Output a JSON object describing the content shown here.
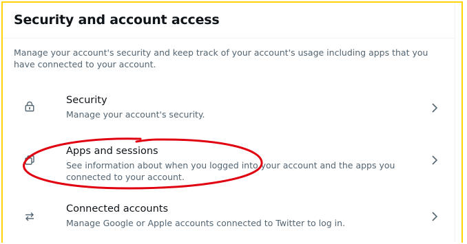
{
  "page": {
    "title": "Security and account access",
    "description": "Manage your account's security and keep track of your account's usage including apps that you have connected to your account."
  },
  "items": [
    {
      "label": "Security",
      "description": "Manage your account's security.",
      "icon": "lock-icon"
    },
    {
      "label": "Apps and sessions",
      "description": "See information about when you logged into your account and the apps you connected to your account.",
      "icon": "apps-icon"
    },
    {
      "label": "Connected accounts",
      "description": "Manage Google or Apple accounts connected to Twitter to log in.",
      "icon": "swap-arrows-icon"
    }
  ],
  "colors": {
    "frame_border": "#ffd400",
    "annotation_circle": "#e0000f",
    "primary_text": "#0f1419",
    "secondary_text": "#536471"
  }
}
